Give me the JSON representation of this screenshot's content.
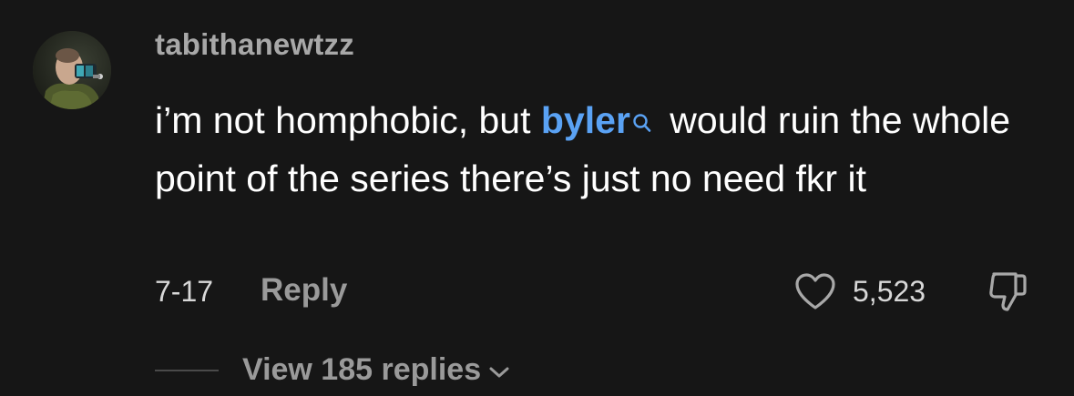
{
  "comment": {
    "username": "tabithanewtzz",
    "text_before": "i’m not homphobic, but ",
    "keyword": "byler",
    "text_after": " would ruin the whole point of the series there’s just no need fkr it",
    "date": "7-17",
    "reply_label": "Reply",
    "like_count": "5,523",
    "view_replies_label": "View 185 replies"
  },
  "icons": {
    "keyword_search": "search-icon",
    "like": "heart-outline-icon",
    "dislike": "thumbs-down-icon",
    "expand": "chevron-down-icon"
  },
  "colors": {
    "background": "#161616",
    "keyword": "#5aa2f4",
    "muted": "#9a9a9a"
  }
}
